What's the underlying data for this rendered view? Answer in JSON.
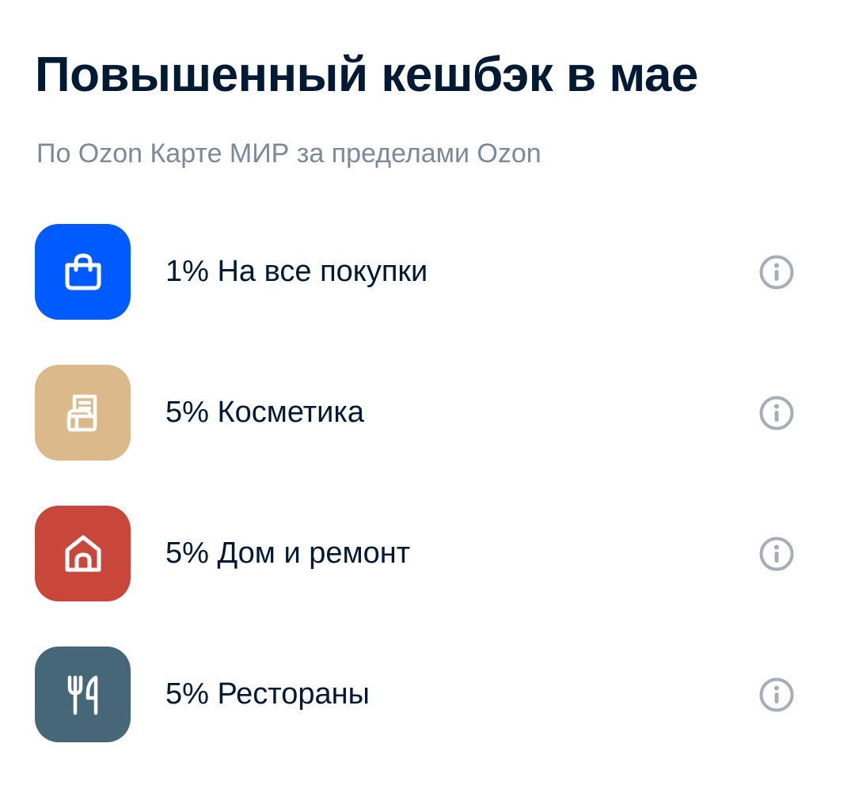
{
  "header": {
    "title": "Повышенный кешбэк в мае",
    "subtitle": "По Ozon Карте МИР за пределами Ozon"
  },
  "categories": [
    {
      "label": "1% На все покупки",
      "icon": "shopping-bag-icon",
      "color": "#005bff"
    },
    {
      "label": "5% Косметика",
      "icon": "cosmetics-icon",
      "color": "#dbb98a"
    },
    {
      "label": "5% Дом и ремонт",
      "icon": "house-icon",
      "color": "#c8473a"
    },
    {
      "label": "5% Рестораны",
      "icon": "fork-knife-icon",
      "color": "#466777"
    }
  ],
  "colors": {
    "text": "#001a34",
    "subtitle": "#7b8a9a",
    "info_icon": "#a4afb9"
  }
}
